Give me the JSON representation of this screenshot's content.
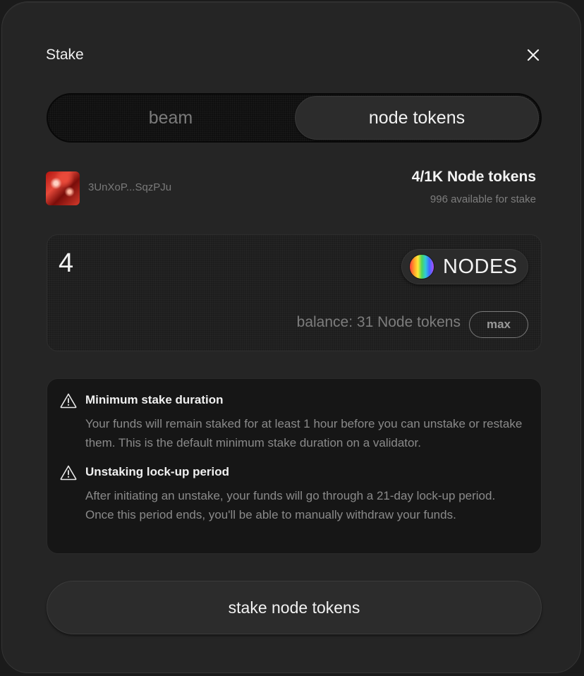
{
  "modal": {
    "title": "Stake",
    "close_icon": "close-icon"
  },
  "tabs": [
    {
      "label": "beam",
      "active": false
    },
    {
      "label": "node tokens",
      "active": true
    }
  ],
  "account": {
    "avatar_icon": "nft-avatar",
    "wallet": "3UnXoP...SqzPJu",
    "token_count": "4/1K Node tokens",
    "available": "996 available for stake"
  },
  "amount": {
    "value": "4",
    "token_symbol": "NODES",
    "token_icon": "nodes-token-icon",
    "balance": "balance: 31 Node tokens",
    "max_label": "max"
  },
  "notices": [
    {
      "icon": "warning-icon",
      "title": "Minimum stake duration",
      "body": "Your funds will remain staked for at least 1 hour before you can unstake or restake them. This is the default minimum stake duration on a validator."
    },
    {
      "icon": "warning-icon",
      "title": "Unstaking lock-up period",
      "body": "After initiating an unstake, your funds will go through a 21-day lock-up period. Once this period ends, you'll be able to manually withdraw your funds."
    }
  ],
  "submit_label": "stake node tokens",
  "colors": {
    "background": "#252525",
    "panel": "#161616",
    "text_primary": "#f0f0f0",
    "text_muted": "#8a8a8a"
  }
}
